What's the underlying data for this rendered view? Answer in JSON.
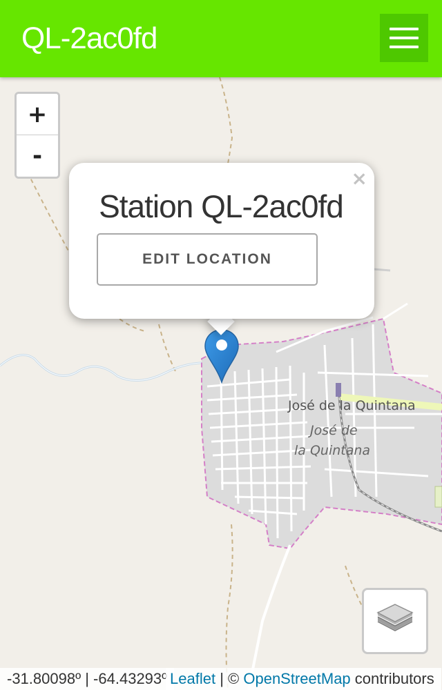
{
  "header": {
    "title": "QL-2ac0fd",
    "menu_icon": "hamburger-menu-icon",
    "background_color": "#66e600",
    "menu_button_color": "#4ec800"
  },
  "map": {
    "zoom_in_label": "+",
    "zoom_out_label": "-",
    "place_labels": {
      "town_label": "José de la Quintana",
      "area_label_line1": "José de",
      "area_label_line2": "la Quintana"
    },
    "marker_icon": "map-pin-icon",
    "marker_color": "#2a81cb",
    "layers_icon": "layers-icon"
  },
  "popup": {
    "close_label": "×",
    "title": "Station QL-2ac0fd",
    "button_label": "EDIT LOCATION"
  },
  "status_bar": {
    "coordinates": "-31.80098º | -64.43293º",
    "leaflet_link": "Leaflet",
    "separator": "| ©",
    "osm_link": "OpenStreetMap",
    "contributors": "contributors"
  }
}
